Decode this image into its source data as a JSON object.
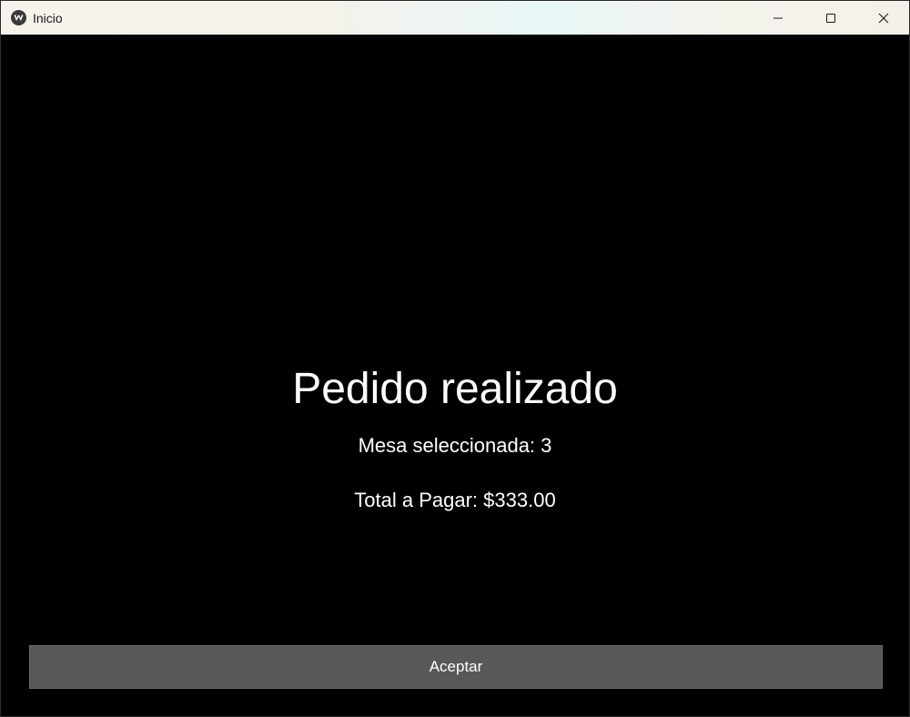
{
  "window": {
    "title": "Inicio",
    "icon": "kivy-logo-icon",
    "controls": {
      "minimize_icon": "minimize-icon",
      "maximize_icon": "maximize-icon",
      "close_icon": "close-icon"
    }
  },
  "main": {
    "heading": "Pedido realizado",
    "mesa_text": "Mesa seleccionada: 3",
    "total_text": "Total a Pagar: $333.00",
    "accept_label": "Aceptar"
  },
  "colors": {
    "background": "#000000",
    "button": "#585858",
    "text": "#ffffff"
  }
}
